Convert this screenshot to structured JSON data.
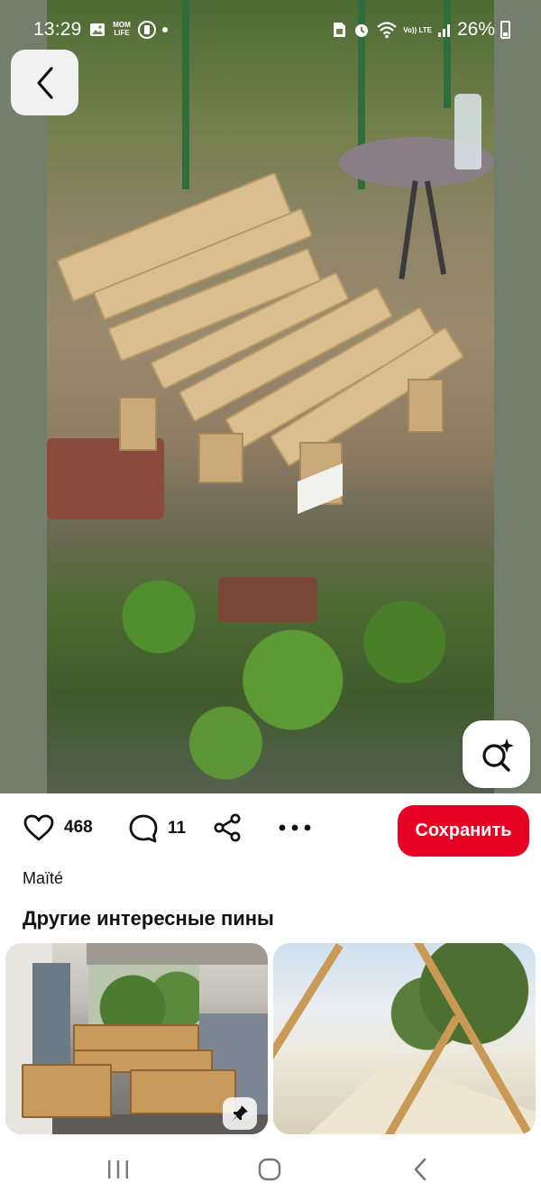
{
  "status_bar": {
    "time": "13:29",
    "app_badge": "MOM LIFE",
    "volte": "Vo)) LTE",
    "battery": "26%"
  },
  "hero": {
    "image": "wooden pallet sofa on grass",
    "back_icon": "chevron-left-icon",
    "lens_icon": "visual-search-icon"
  },
  "actions": {
    "likes": "468",
    "comments": "11",
    "save_label": "Сохранить"
  },
  "author": "Maïté",
  "more_section": {
    "title": "Другие интересные пины"
  },
  "colors": {
    "accent": "#e60023",
    "text": "#111111"
  }
}
